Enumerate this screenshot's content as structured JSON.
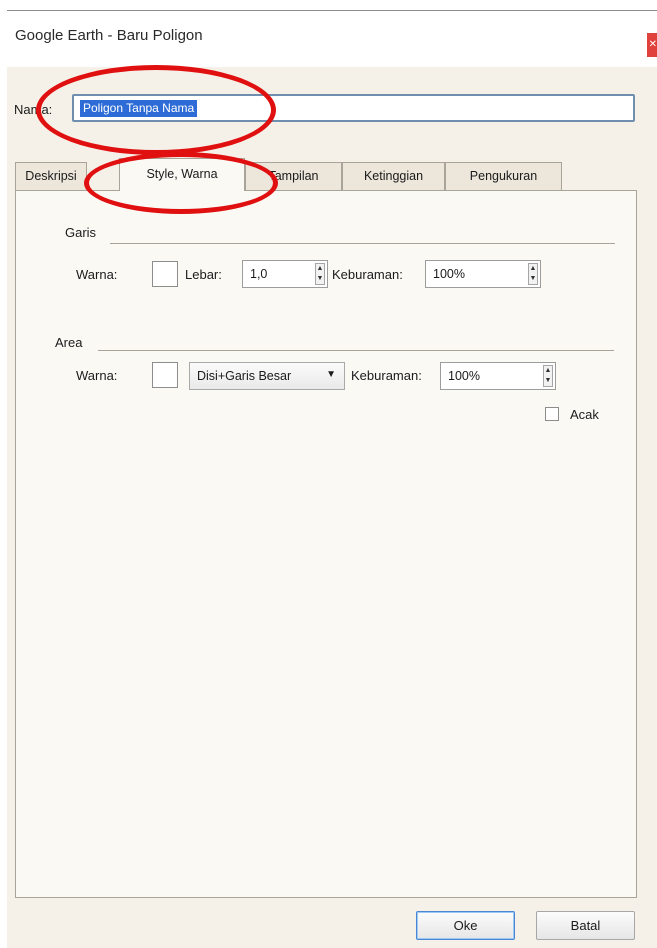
{
  "window": {
    "title": "Google Earth - Baru Poligon",
    "close_symbol": "✕"
  },
  "name_field": {
    "label": "Nama:",
    "value": "Poligon Tanpa Nama"
  },
  "tabs": [
    {
      "label": "Deskripsi",
      "active": false
    },
    {
      "label": "Style, Warna",
      "active": true
    },
    {
      "label": "Tampilan",
      "active": false
    },
    {
      "label": "Ketinggian",
      "active": false
    },
    {
      "label": "Pengukuran",
      "active": false
    }
  ],
  "garis": {
    "heading": "Garis",
    "color_label": "Warna:",
    "width_label": "Lebar:",
    "width_value": "1,0",
    "opacity_label": "Keburaman:",
    "opacity_value": "100%"
  },
  "area": {
    "heading": "Area",
    "color_label": "Warna:",
    "fill_mode": "Disi+Garis Besar",
    "opacity_label": "Keburaman:",
    "opacity_value": "100%",
    "random_label": "Acak",
    "random_checked": false
  },
  "buttons": {
    "ok": "Oke",
    "cancel": "Batal"
  },
  "colors": {
    "highlight_ring": "#e01010",
    "selection": "#2d6cd6"
  }
}
